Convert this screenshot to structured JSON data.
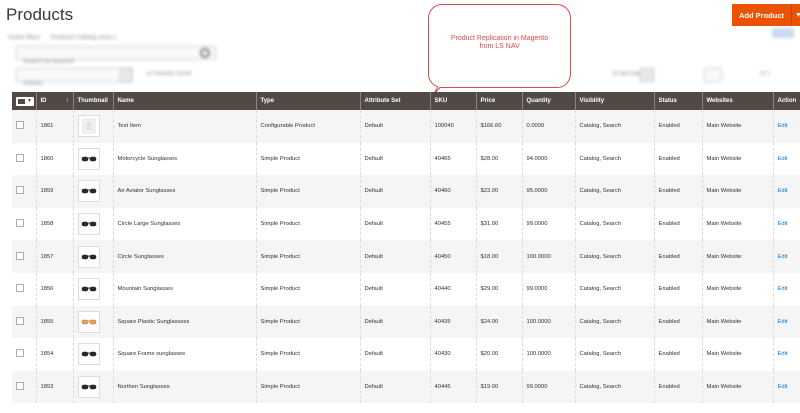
{
  "page": {
    "title": "Products"
  },
  "add_product": {
    "label": "Add Product",
    "dropdown_icon": "chevron-down-icon"
  },
  "callout": {
    "text_line1": "Product Replication in Magento",
    "text_line2": "from LS NAV"
  },
  "toolbar_blurred": {
    "breadcrumb": "Active filters",
    "breadcrumb_value": "Products Catalog store 1",
    "search_placeholder": "Search by keyword",
    "actions_label": "Actions",
    "records_found": "10 records found",
    "per_page": "20 per page",
    "page_label": "of 1"
  },
  "columns": {
    "select": "",
    "id": "ID",
    "thumbnail": "Thumbnail",
    "name": "Name",
    "type": "Type",
    "attribute_set": "Attribute Set",
    "sku": "SKU",
    "price": "Price",
    "quantity": "Quantity",
    "visibility": "Visibility",
    "status": "Status",
    "websites": "Websites",
    "action": "Action"
  },
  "rows": [
    {
      "id": "1861",
      "name": "Test Item",
      "type": "Configurable Product",
      "attribute_set": "Default",
      "sku": "100040",
      "price": "$166.60",
      "quantity": "0.0000",
      "visibility": "Catalog, Search",
      "status": "Enabled",
      "websites": "Main Website",
      "action": "Edit",
      "thumb": "placeholder"
    },
    {
      "id": "1860",
      "name": "Motorcycle Sunglasses",
      "type": "Simple Product",
      "attribute_set": "Default",
      "sku": "40465",
      "price": "$28.00",
      "quantity": "94.0000",
      "visibility": "Catalog, Search",
      "status": "Enabled",
      "websites": "Main Website",
      "action": "Edit",
      "thumb": "sunglasses"
    },
    {
      "id": "1859",
      "name": "Air Aviator Sunglasses",
      "type": "Simple Product",
      "attribute_set": "Default",
      "sku": "40460",
      "price": "$23.00",
      "quantity": "95.0000",
      "visibility": "Catalog, Search",
      "status": "Enabled",
      "websites": "Main Website",
      "action": "Edit",
      "thumb": "sunglasses"
    },
    {
      "id": "1858",
      "name": "Circle Large Sunglasses",
      "type": "Simple Product",
      "attribute_set": "Default",
      "sku": "40455",
      "price": "$31.00",
      "quantity": "99.0000",
      "visibility": "Catalog, Search",
      "status": "Enabled",
      "websites": "Main Website",
      "action": "Edit",
      "thumb": "sunglasses"
    },
    {
      "id": "1857",
      "name": "Circle Sunglasses",
      "type": "Simple Product",
      "attribute_set": "Default",
      "sku": "40450",
      "price": "$18.00",
      "quantity": "100.0000",
      "visibility": "Catalog, Search",
      "status": "Enabled",
      "websites": "Main Website",
      "action": "Edit",
      "thumb": "sunglasses"
    },
    {
      "id": "1856",
      "name": "Mountain Sunglasses",
      "type": "Simple Product",
      "attribute_set": "Default",
      "sku": "40440",
      "price": "$29.00",
      "quantity": "99.0000",
      "visibility": "Catalog, Search",
      "status": "Enabled",
      "websites": "Main Website",
      "action": "Edit",
      "thumb": "sunglasses"
    },
    {
      "id": "1855",
      "name": "Square Plastic Sunglassess",
      "type": "Simple Product",
      "attribute_set": "Default",
      "sku": "40435",
      "price": "$24.00",
      "quantity": "100.0000",
      "visibility": "Catalog, Search",
      "status": "Enabled",
      "websites": "Main Website",
      "action": "Edit",
      "thumb": "sunglasses-orange"
    },
    {
      "id": "1854",
      "name": "Square Frame sunglasses",
      "type": "Simple Product",
      "attribute_set": "Default",
      "sku": "40430",
      "price": "$20.00",
      "quantity": "100.0000",
      "visibility": "Catalog, Search",
      "status": "Enabled",
      "websites": "Main Website",
      "action": "Edit",
      "thumb": "sunglasses"
    },
    {
      "id": "1853",
      "name": "Northen Sunglasses",
      "type": "Simple Product",
      "attribute_set": "Default",
      "sku": "40445",
      "price": "$19.00",
      "quantity": "99.0000",
      "visibility": "Catalog, Search",
      "status": "Enabled",
      "websites": "Main Website",
      "action": "Edit",
      "thumb": "sunglasses"
    }
  ],
  "colors": {
    "accent": "#eb5202",
    "header_bg": "#514943",
    "link": "#007bdb",
    "callout": "#d94a4a"
  }
}
